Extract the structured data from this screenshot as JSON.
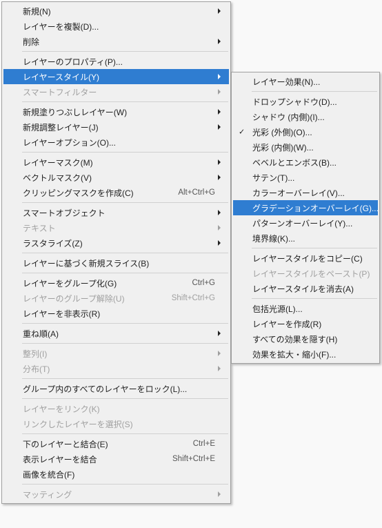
{
  "main_menu": {
    "groups": [
      [
        {
          "label": "新規(N)",
          "disabled": false,
          "submenu": true
        },
        {
          "label": "レイヤーを複製(D)...",
          "disabled": false
        },
        {
          "label": "削除",
          "disabled": false,
          "submenu": true
        }
      ],
      [
        {
          "label": "レイヤーのプロパティ(P)...",
          "disabled": false
        },
        {
          "label": "レイヤースタイル(Y)",
          "disabled": false,
          "submenu": true,
          "highlighted": true
        },
        {
          "label": "スマートフィルター",
          "disabled": true,
          "submenu": true
        }
      ],
      [
        {
          "label": "新規塗りつぶしレイヤー(W)",
          "disabled": false,
          "submenu": true
        },
        {
          "label": "新規調整レイヤー(J)",
          "disabled": false,
          "submenu": true
        },
        {
          "label": "レイヤーオプション(O)...",
          "disabled": false
        }
      ],
      [
        {
          "label": "レイヤーマスク(M)",
          "disabled": false,
          "submenu": true
        },
        {
          "label": "ベクトルマスク(V)",
          "disabled": false,
          "submenu": true
        },
        {
          "label": "クリッピングマスクを作成(C)",
          "disabled": false,
          "accel": "Alt+Ctrl+G"
        }
      ],
      [
        {
          "label": "スマートオブジェクト",
          "disabled": false,
          "submenu": true
        },
        {
          "label": "テキスト",
          "disabled": true,
          "submenu": true
        },
        {
          "label": "ラスタライズ(Z)",
          "disabled": false,
          "submenu": true
        }
      ],
      [
        {
          "label": "レイヤーに基づく新規スライス(B)",
          "disabled": false
        }
      ],
      [
        {
          "label": "レイヤーをグループ化(G)",
          "disabled": false,
          "accel": "Ctrl+G"
        },
        {
          "label": "レイヤーのグループ解除(U)",
          "disabled": true,
          "accel": "Shift+Ctrl+G"
        },
        {
          "label": "レイヤーを非表示(R)",
          "disabled": false
        }
      ],
      [
        {
          "label": "重ね順(A)",
          "disabled": false,
          "submenu": true
        }
      ],
      [
        {
          "label": "整列(I)",
          "disabled": true,
          "submenu": true
        },
        {
          "label": "分布(T)",
          "disabled": true,
          "submenu": true
        }
      ],
      [
        {
          "label": "グループ内のすべてのレイヤーをロック(L)...",
          "disabled": false
        }
      ],
      [
        {
          "label": "レイヤーをリンク(K)",
          "disabled": true
        },
        {
          "label": "リンクしたレイヤーを選択(S)",
          "disabled": true
        }
      ],
      [
        {
          "label": "下のレイヤーと結合(E)",
          "disabled": false,
          "accel": "Ctrl+E"
        },
        {
          "label": "表示レイヤーを結合",
          "disabled": false,
          "accel": "Shift+Ctrl+E"
        },
        {
          "label": "画像を統合(F)",
          "disabled": false
        }
      ],
      [
        {
          "label": "マッティング",
          "disabled": true,
          "submenu": true
        }
      ]
    ]
  },
  "sub_menu": {
    "groups": [
      [
        {
          "label": "レイヤー効果(N)..."
        }
      ],
      [
        {
          "label": "ドロップシャドウ(D)..."
        },
        {
          "label": "シャドウ (内側)(I)..."
        },
        {
          "label": "光彩 (外側)(O)...",
          "checked": true
        },
        {
          "label": "光彩 (内側)(W)..."
        },
        {
          "label": "ベベルとエンボス(B)..."
        },
        {
          "label": "サテン(T)..."
        },
        {
          "label": "カラーオーバーレイ(V)..."
        },
        {
          "label": "グラデーションオーバーレイ(G)...",
          "highlighted": true
        },
        {
          "label": "パターンオーバーレイ(Y)..."
        },
        {
          "label": "境界線(K)..."
        }
      ],
      [
        {
          "label": "レイヤースタイルをコピー(C)"
        },
        {
          "label": "レイヤースタイルをペースト(P)",
          "disabled": true
        },
        {
          "label": "レイヤースタイルを消去(A)"
        }
      ],
      [
        {
          "label": "包括光源(L)..."
        },
        {
          "label": "レイヤーを作成(R)"
        },
        {
          "label": "すべての効果を隠す(H)"
        },
        {
          "label": "効果を拡大・縮小(F)..."
        }
      ]
    ]
  }
}
